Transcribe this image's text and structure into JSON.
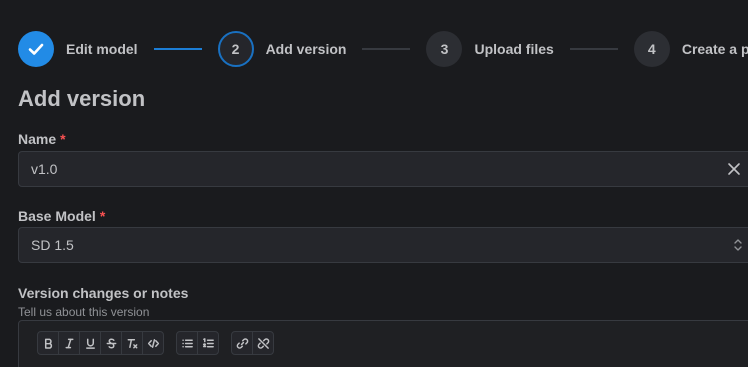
{
  "stepper": {
    "steps": [
      {
        "number": "",
        "label": "Edit model",
        "state": "done"
      },
      {
        "number": "2",
        "label": "Add version",
        "state": "active"
      },
      {
        "number": "3",
        "label": "Upload files",
        "state": "pending"
      },
      {
        "number": "4",
        "label": "Create a post",
        "state": "pending"
      }
    ]
  },
  "page": {
    "title": "Add version"
  },
  "form": {
    "name": {
      "label": "Name",
      "required_mark": "*",
      "value": "v1.0"
    },
    "base_model": {
      "label": "Base Model",
      "required_mark": "*",
      "value": "SD 1.5"
    },
    "notes": {
      "label": "Version changes or notes",
      "description": "Tell us about this version"
    }
  },
  "editor": {
    "toolbar_icons": [
      "bold-icon",
      "italic-icon",
      "underline-icon",
      "strikethrough-icon",
      "clear-formatting-icon",
      "code-icon",
      "bullet-list-icon",
      "numbered-list-icon",
      "link-icon",
      "unlink-icon"
    ]
  },
  "colors": {
    "accent": "#228be6",
    "required": "#fa5252",
    "background": "#1a1b1e"
  }
}
